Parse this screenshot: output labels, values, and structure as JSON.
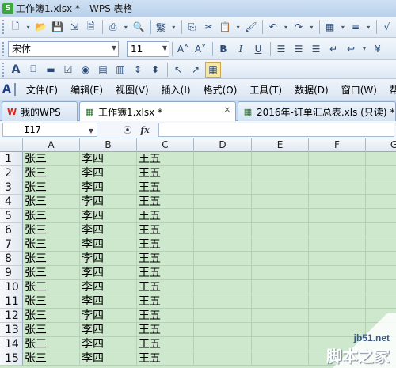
{
  "window": {
    "title": "工作簿1.xlsx * - WPS 表格",
    "app_icon": "S"
  },
  "toolbar_font": {
    "font_name": "宋体",
    "font_size": "11",
    "bold": "B",
    "italic": "I",
    "underline": "U"
  },
  "menu": {
    "items": [
      "文件(F)",
      "编辑(E)",
      "视图(V)",
      "插入(I)",
      "格式(O)",
      "工具(T)",
      "数据(D)",
      "窗口(W)",
      "帮助"
    ]
  },
  "tabs": [
    {
      "label": "我的WPS",
      "icon": "wps-icon"
    },
    {
      "label": "工作簿1.xlsx *",
      "icon": "sheet-icon",
      "active": true
    },
    {
      "label": "2016年-订单汇总表.xls (只读) *",
      "icon": "sheet-icon"
    }
  ],
  "formula_bar": {
    "name_box": "I17",
    "fx_label": "fx",
    "zoom_icon": "⦿"
  },
  "sheet": {
    "columns": [
      "A",
      "B",
      "C",
      "D",
      "E",
      "F",
      "G"
    ],
    "rows": [
      {
        "num": "1",
        "cells": [
          "张三",
          "李四",
          "王五"
        ]
      },
      {
        "num": "2",
        "cells": [
          "张三",
          "李四",
          "王五"
        ]
      },
      {
        "num": "3",
        "cells": [
          "张三",
          "李四",
          "王五"
        ]
      },
      {
        "num": "4",
        "cells": [
          "张三",
          "李四",
          "王五"
        ]
      },
      {
        "num": "5",
        "cells": [
          "张三",
          "李四",
          "王五"
        ]
      },
      {
        "num": "6",
        "cells": [
          "张三",
          "李四",
          "王五"
        ]
      },
      {
        "num": "7",
        "cells": [
          "张三",
          "李四",
          "王五"
        ]
      },
      {
        "num": "8",
        "cells": [
          "张三",
          "李四",
          "王五"
        ]
      },
      {
        "num": "9",
        "cells": [
          "张三",
          "李四",
          "王五"
        ]
      },
      {
        "num": "10",
        "cells": [
          "张三",
          "李四",
          "王五"
        ]
      },
      {
        "num": "11",
        "cells": [
          "张三",
          "李四",
          "王五"
        ]
      },
      {
        "num": "12",
        "cells": [
          "张三",
          "李四",
          "王五"
        ]
      },
      {
        "num": "13",
        "cells": [
          "张三",
          "李四",
          "王五"
        ]
      },
      {
        "num": "14",
        "cells": [
          "张三",
          "李四",
          "王五"
        ]
      },
      {
        "num": "15",
        "cells": [
          "张三",
          "李四",
          "王五"
        ]
      }
    ]
  },
  "watermark": {
    "top": "jb51.net",
    "bottom": "脚本之家"
  },
  "colors": {
    "sheet_background": "#cde8cd",
    "accent": "#1c3f88"
  }
}
